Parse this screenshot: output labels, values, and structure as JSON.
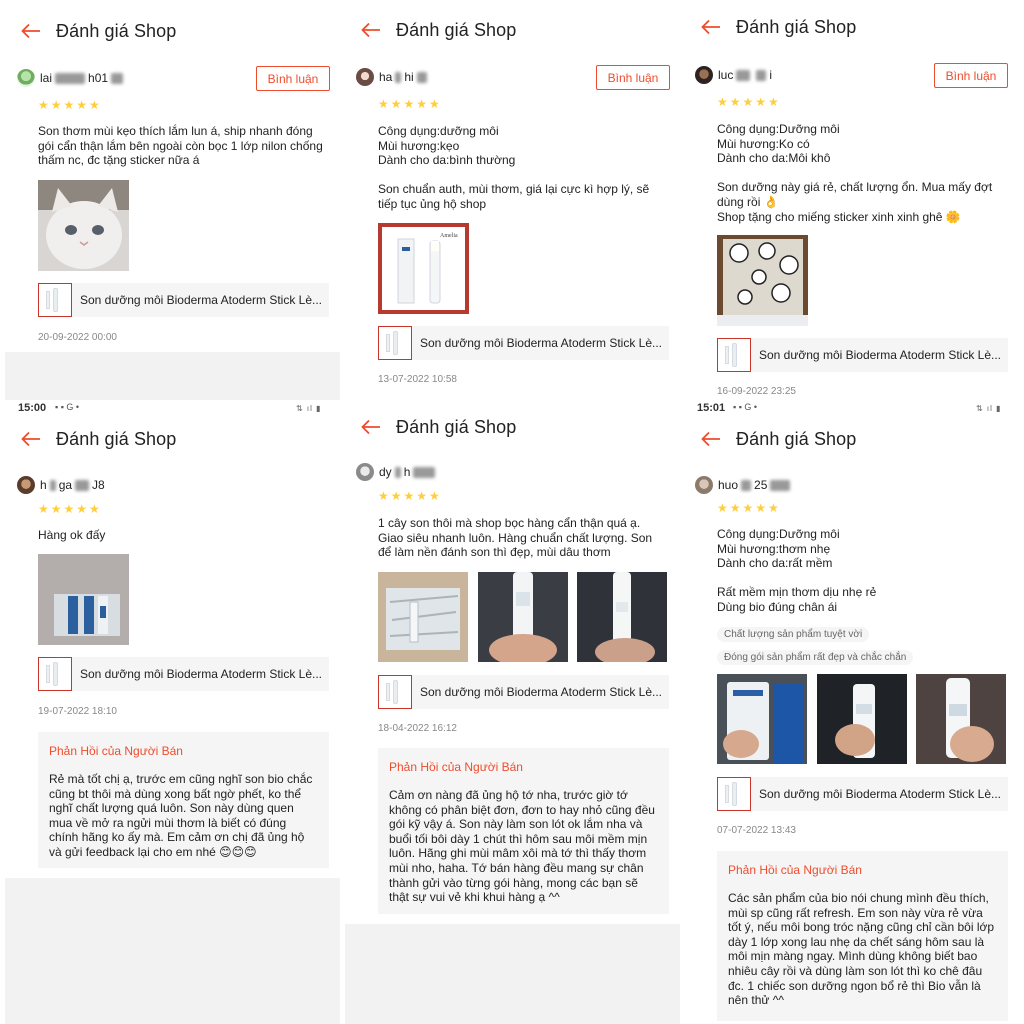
{
  "common": {
    "header_title": "Đánh giá Shop",
    "reply_label": "Bình luận",
    "product_name": "Son dưỡng môi Bioderma Atoderm Stick Lè...",
    "seller_reply_title": "Phản Hồi của Người Bán",
    "stars": "★★★★★",
    "rating": 5
  },
  "status_bar": {
    "left_time": "15:00",
    "right_time": "15:01",
    "left_icons": "▪ ▪ G •",
    "right_icons": "⇅ ıl ▮"
  },
  "reviews": [
    {
      "user_a": "lai",
      "user_b": "h01",
      "text": "Son thơm mùi kẹo thích lắm lun á, ship nhanh đóng gói cẩn thận lắm bên ngoài còn bọc 1 lớp nilon chống thấm nc, đc tặng sticker nữa á",
      "date": "20-09-2022 00:00"
    },
    {
      "user_a": "ha",
      "user_b": "hi",
      "text": "Công dụng:dưỡng môi\nMùi hương:kẹo\nDành cho da:bình thường\n\nSon chuẩn auth, mùi thơm, giá lại cực kì hợp lý, sẽ tiếp tục ủng hộ shop",
      "date": "13-07-2022 10:58"
    },
    {
      "user_a": "luc",
      "user_b": "i",
      "text": "Công dụng:Dưỡng môi\nMùi hương:Ko có\nDành cho da:Môi khô\n\nSon dưỡng này giá rẻ, chất lượng ổn. Mua mấy đợt dùng rồi 👌\nShop tặng cho miếng sticker xinh xinh ghê 🌼",
      "date": "16-09-2022 23:25"
    },
    {
      "user_a": "h",
      "user_b": "ga",
      "user_c": "J8",
      "text": "Hàng ok đấy",
      "date": "19-07-2022 18:10",
      "seller_reply": "Rẻ mà tốt chị ạ, trước em cũng nghĩ son bio chắc cũng bt thôi mà dùng xong bất ngờ phết, ko thể nghĩ chất lượng quá luôn. Son này dùng quen mua về mở ra ngửi mùi thơm là biết có đúng chính hãng ko ấy mà. Em cảm ơn chị đã ủng hộ và gửi feedback lại cho em nhé 😊😊😊"
    },
    {
      "user_a": "dy",
      "user_b": "h",
      "text": "1 cây son thôi mà shop bọc hàng cẩn thận quá ạ. Giao siêu nhanh luôn. Hàng chuẩn chất lượng. Son để làm nền đánh son thì đẹp, mùi dâu thơm",
      "date": "18-04-2022 16:12",
      "seller_reply": "Cảm ơn nàng đã ủng hộ tớ nha, trước giờ tớ không có phân biệt đơn, đơn to hay nhỏ cũng đều gói kỹ vậy á. Son này làm son lót ok lắm nha và buổi tối bôi dày 1 chút thì hôm sau môi mềm mịn luôn. Hãng ghi mùi mâm xôi mà tớ thì thấy thơm mùi nho, haha. Tớ bán hàng đều mang sự chân thành gửi vào từng gói hàng, mong các bạn sẽ thật sự vui vẻ khi khui hàng ạ ^^"
    },
    {
      "user_a": "huo",
      "user_b": "25",
      "text": "Công dụng:Dưỡng môi\nMùi hương:thơm nhẹ\nDành cho da:rất mềm\n\nRất mềm mịn thơm dịu nhẹ rẻ\nDùng bio đúng chân ái",
      "tags": [
        "Chất lượng sản phẩm tuyệt vời",
        "Đóng gói sản phẩm rất đẹp và chắc chắn"
      ],
      "date": "07-07-2022 13:43",
      "seller_reply": "Các sản phẩm của bio nói chung mình đều thích, mùi sp cũng rất refresh. Em son này vừa rẻ vừa tốt ý, nếu môi bong tróc nặng cũng chỉ cần bôi lớp dày 1 lớp xong lau nhẹ da chết sáng hôm sau là môi mịn màng ngay. Mình dùng không biết bao nhiêu cây rồi và dùng làm son lót thì ko chê đâu đc. 1 chiếc son dưỡng ngon bổ rẻ thì Bio vẫn là nên thử ^^"
    }
  ],
  "image_labels": {
    "bioderma_brand": "Atoderm",
    "box_brand": "Amelia"
  }
}
